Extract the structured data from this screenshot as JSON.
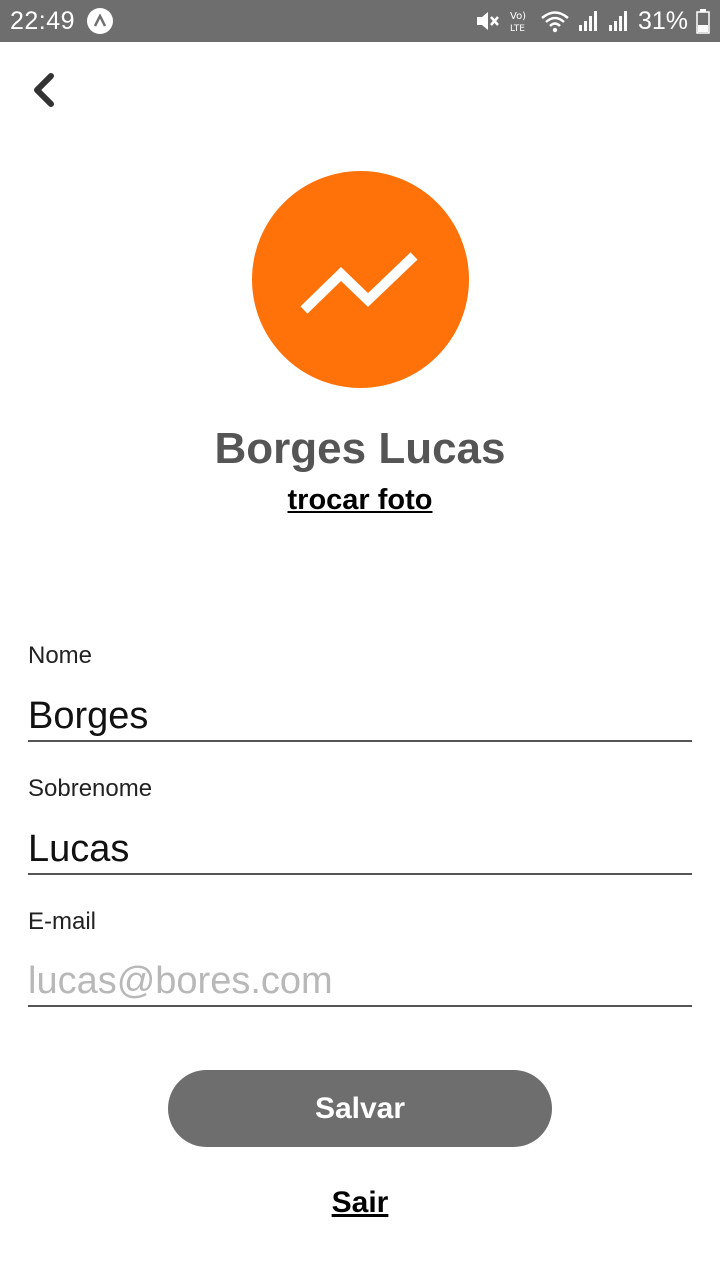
{
  "status_bar": {
    "time": "22:49",
    "battery_text": "31%",
    "icons": [
      "app-a-icon",
      "mute-icon",
      "volte-icon",
      "wifi-icon",
      "signal-icon",
      "signal-icon-2",
      "battery-icon"
    ]
  },
  "header": {
    "back_icon": "chevron-left-icon"
  },
  "profile": {
    "avatar_color": "#ff7209",
    "avatar_icon": "trending-line-icon",
    "name": "Borges Lucas",
    "change_photo_label": "trocar foto"
  },
  "form": {
    "first_name": {
      "label": "Nome",
      "value": "Borges"
    },
    "last_name": {
      "label": "Sobrenome",
      "value": "Lucas"
    },
    "email": {
      "label": "E-mail",
      "value": "",
      "placeholder": "lucas@bores.com"
    }
  },
  "actions": {
    "save_label": "Salvar",
    "logout_label": "Sair"
  }
}
